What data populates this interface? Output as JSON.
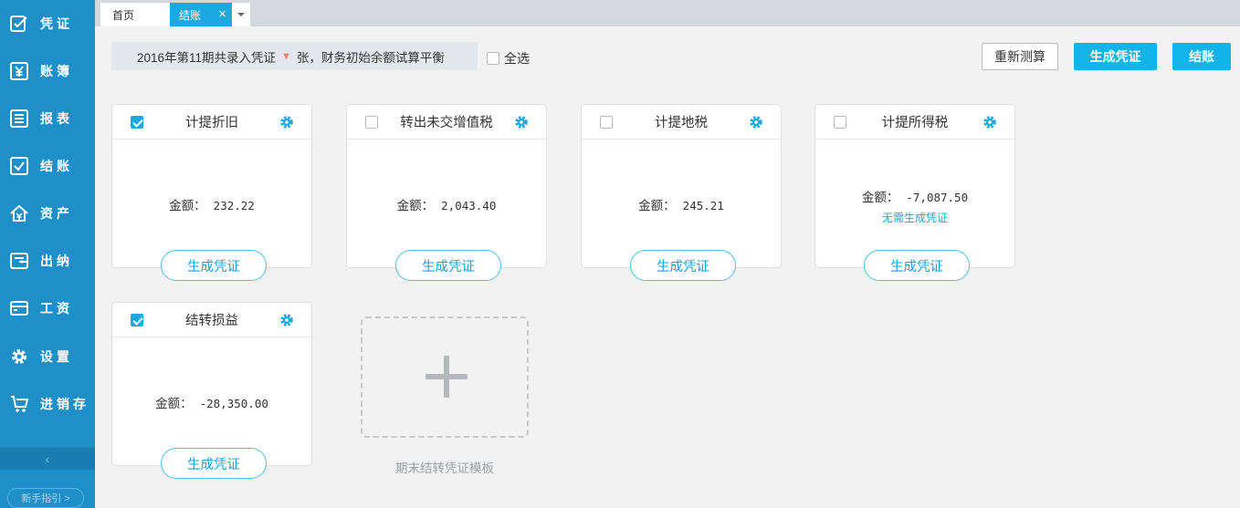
{
  "sidebar": {
    "items": [
      {
        "label": "凭证",
        "icon": "voucher-edit-icon"
      },
      {
        "label": "账簿",
        "icon": "ledger-yen-icon"
      },
      {
        "label": "报表",
        "icon": "report-list-icon"
      },
      {
        "label": "结账",
        "icon": "checkout-check-icon"
      },
      {
        "label": "资产",
        "icon": "asset-home-icon"
      },
      {
        "label": "出纳",
        "icon": "cashier-wallet-icon"
      },
      {
        "label": "工资",
        "icon": "salary-card-icon"
      },
      {
        "label": "设置",
        "icon": "gear-icon"
      },
      {
        "label": "进销存",
        "icon": "cart-icon"
      }
    ],
    "collapse": "‹",
    "guide": "新手指引 >"
  },
  "tabs": [
    {
      "label": "首页"
    },
    {
      "label": "结账",
      "close": "×"
    }
  ],
  "header": {
    "info_prefix": "2016年第11期共录入凭证",
    "info_suffix": "张，财务初始余额试算平衡",
    "select_all": "全选",
    "recalc": "重新测算",
    "generate": "生成凭证",
    "checkout": "结账"
  },
  "cards": [
    {
      "title": "计提折旧",
      "checked": true,
      "amount_label": "金额：",
      "amount": "232.22",
      "button": "生成凭证"
    },
    {
      "title": "转出未交增值税",
      "checked": false,
      "amount_label": "金额：",
      "amount": "2,043.40",
      "button": "生成凭证"
    },
    {
      "title": "计提地税",
      "checked": false,
      "amount_label": "金额：",
      "amount": "245.21",
      "button": "生成凭证"
    },
    {
      "title": "计提所得税",
      "checked": false,
      "amount_label": "金额：",
      "amount": "-7,087.50",
      "note": "无需生成凭证",
      "button": "生成凭证"
    },
    {
      "title": "结转损益",
      "checked": true,
      "amount_label": "金额：",
      "amount": "-28,350.00",
      "button": "生成凭证"
    }
  ],
  "template_add": {
    "label": "期末结转凭证模板"
  },
  "colors": {
    "sidebar": "#1f8fc9",
    "accent": "#12b3ea",
    "link": "#18a6dc"
  }
}
